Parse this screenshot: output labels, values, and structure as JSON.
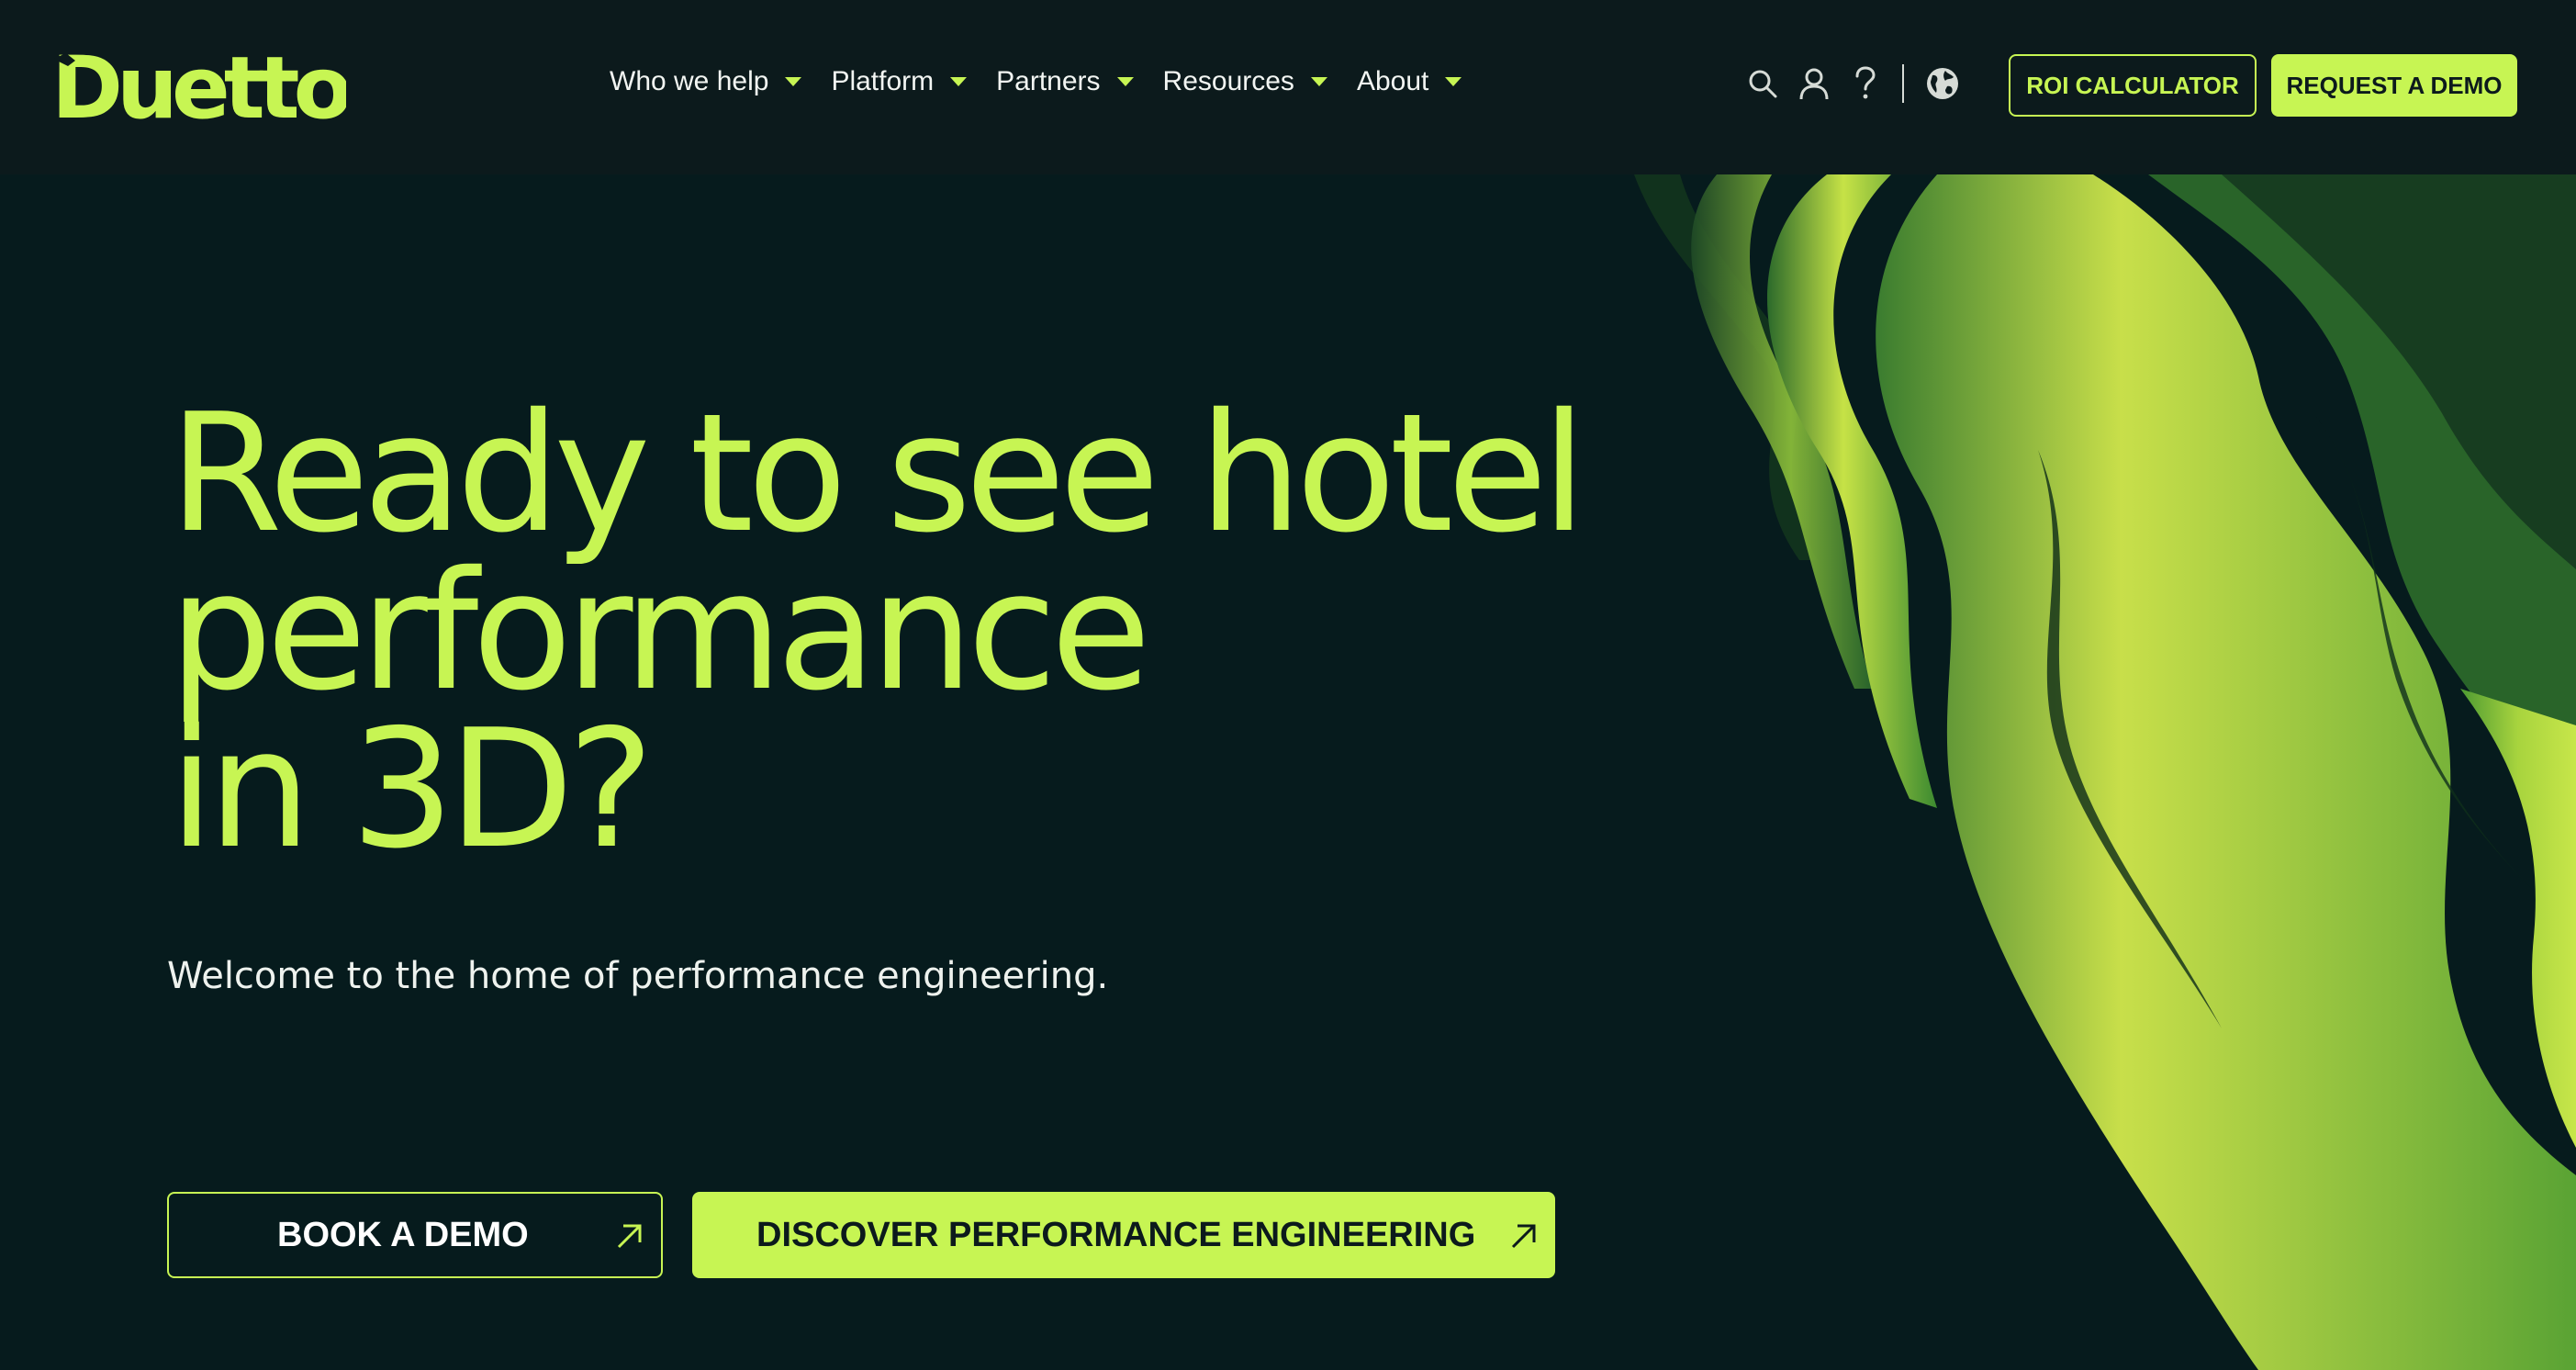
{
  "brand": {
    "name": "Duetto",
    "accent": "#c7f553",
    "background": "#061b1d",
    "header_bg": "#0c1a1c"
  },
  "nav": {
    "items": [
      {
        "label": "Who we help"
      },
      {
        "label": "Platform"
      },
      {
        "label": "Partners"
      },
      {
        "label": "Resources"
      },
      {
        "label": "About"
      }
    ]
  },
  "utilities": {
    "icons": [
      "search-icon",
      "account-icon",
      "help-icon",
      "globe-icon"
    ]
  },
  "header_buttons": {
    "roi": "ROI CALCULATOR",
    "request_demo": "REQUEST A DEMO"
  },
  "hero": {
    "title_lines": [
      "Ready to see hotel",
      "performance",
      "in 3D?"
    ],
    "subtitle": "Welcome to the home of performance engineering.",
    "cta_primary": "BOOK A DEMO",
    "cta_secondary": "DISCOVER PERFORMANCE ENGINEERING"
  }
}
